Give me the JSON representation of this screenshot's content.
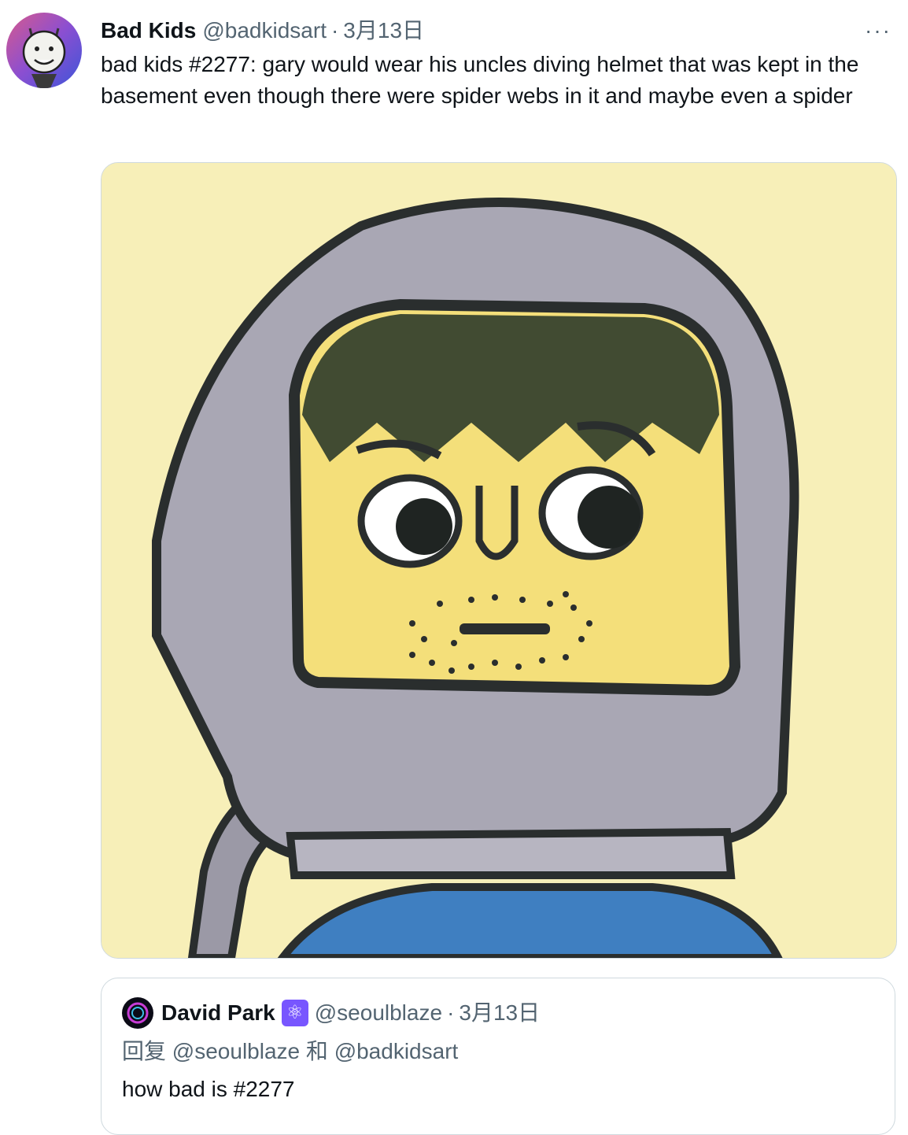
{
  "tweet": {
    "author_name": "Bad Kids",
    "author_handle": "@badkidsart",
    "separator": "·",
    "date": "3月13日",
    "more_label": "···",
    "text": "bad kids #2277: gary would wear his uncles diving helmet that was kept in the basement even though there were spider webs in it and maybe even a spider",
    "avatar_icon": "bad-kid-face-avatar",
    "media_icon": "diving-helmet-kid-drawing"
  },
  "quote": {
    "author_name": "David Park",
    "badge_icon": "atom-badge-icon",
    "badge_glyph": "⚛",
    "author_handle": "@seoulblaze",
    "separator": "·",
    "date": "3月13日",
    "reply_prefix": "回复",
    "reply_user1": "@seoulblaze",
    "reply_and": "和",
    "reply_user2": "@badkidsart",
    "text": "how bad is #2277"
  },
  "colors": {
    "text_primary": "#0f1419",
    "text_secondary": "#536471",
    "border": "#cfd9de",
    "art_background": "#f7efb8",
    "helmet_gray": "#a9a7b4",
    "face_yellow": "#f4df7a",
    "shirt_blue": "#3f7fc1",
    "badge_purple": "#7856ff"
  }
}
